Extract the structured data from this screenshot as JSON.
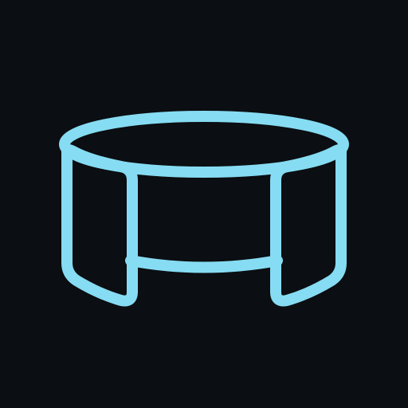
{
  "icon": {
    "name": "panorama-360-icon",
    "stroke_color": "#86dcf2",
    "background_color": "#0b0e12"
  }
}
